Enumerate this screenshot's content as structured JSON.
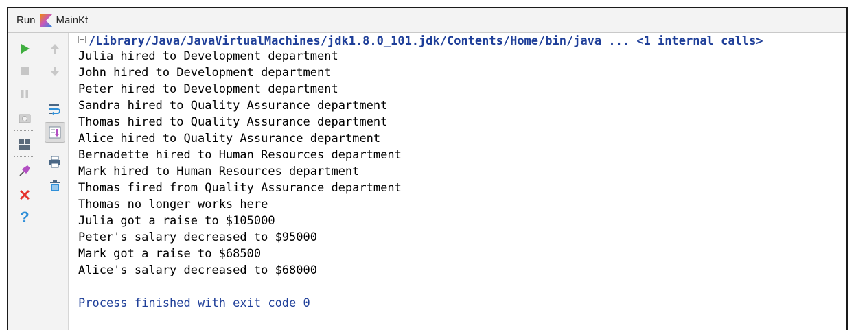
{
  "header": {
    "run_label": "Run",
    "config_name": "MainKt"
  },
  "console": {
    "command": "/Library/Java/JavaVirtualMachines/jdk1.8.0_101.jdk/Contents/Home/bin/java ... <1 internal calls>",
    "lines": [
      "Julia hired to Development department",
      "John hired to Development department",
      "Peter hired to Development department",
      "Sandra hired to Quality Assurance department",
      "Thomas hired to Quality Assurance department",
      "Alice hired to Quality Assurance department",
      "Bernadette hired to Human Resources department",
      "Mark hired to Human Resources department",
      "Thomas fired from Quality Assurance department",
      "Thomas no longer works here",
      "Julia got a raise to $105000",
      "Peter's salary decreased to $95000",
      "Mark got a raise to $68500",
      "Alice's salary decreased to $68000"
    ],
    "finish": "Process finished with exit code 0"
  },
  "toolbar": {
    "left": [
      "run-icon",
      "stop-icon",
      "pause-icon",
      "camera-icon",
      "layout-icon",
      "pin-icon",
      "close-icon",
      "help-icon"
    ],
    "right": [
      "up-arrow-icon",
      "down-arrow-icon",
      "soft-wrap-icon",
      "scroll-to-end-icon",
      "print-icon",
      "trash-icon"
    ]
  },
  "colors": {
    "command": "#1f3f99",
    "run_green": "#3fae3f",
    "close_red": "#e5322d",
    "help_blue": "#2f8fd8",
    "pin_purple": "#b24fc2",
    "panel_bg": "#f3f3f3"
  }
}
